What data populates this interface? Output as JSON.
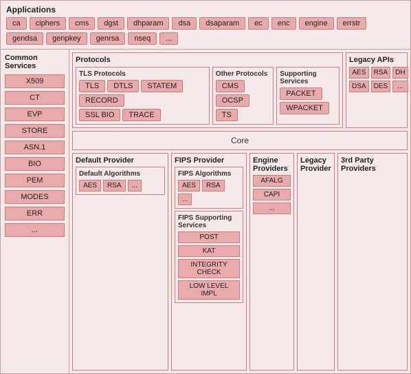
{
  "applications": {
    "title": "Applications",
    "tags": [
      "ca",
      "ciphers",
      "cms",
      "dgst",
      "dhparam",
      "dsa",
      "dsaparam",
      "ec",
      "enc",
      "engine",
      "errstr",
      "gendsa",
      "genpkey",
      "genrsa",
      "nseq",
      "..."
    ]
  },
  "common_services": {
    "title": "Common Services",
    "items": [
      "X509",
      "CT",
      "EVP",
      "STORE",
      "ASN.1",
      "BIO",
      "PEM",
      "MODES",
      "ERR",
      "..."
    ]
  },
  "protocols": {
    "title": "Protocols",
    "tls": {
      "title": "TLS Protocols",
      "row1": [
        "TLS",
        "DTLS",
        "STATEM",
        "RECORD"
      ],
      "row2": [
        "SSL BIO",
        "TRACE"
      ]
    },
    "other": {
      "title": "Other Protocols",
      "items": [
        "CMS",
        "OCSP",
        "TS"
      ]
    },
    "supporting": {
      "title": "Supporting Services",
      "items": [
        "PACKET",
        "WPACKET"
      ]
    }
  },
  "legacy_apis": {
    "title": "Legacy APIs",
    "items": [
      "AES",
      "RSA",
      "DH",
      "DSA",
      "DES",
      "..."
    ]
  },
  "core": {
    "label": "Core"
  },
  "default_provider": {
    "title": "Default Provider",
    "algorithms_title": "Default Algorithms",
    "algorithms": [
      "AES",
      "RSA",
      "..."
    ]
  },
  "fips_provider": {
    "title": "FIPS Provider",
    "algorithms_title": "FIPS Algorithms",
    "algorithms": [
      "AES",
      "RSA",
      "..."
    ],
    "supporting_title": "FIPS Supporting Services",
    "supporting_items": [
      "POST",
      "KAT",
      "INTEGRITY CHECK",
      "LOW LEVEL IMPL"
    ]
  },
  "engine_providers": {
    "title": "Engine Providers",
    "items": [
      "AFALG",
      "CAPI",
      "..."
    ]
  },
  "legacy_provider": {
    "title": "Legacy Provider"
  },
  "third_party_providers": {
    "title": "3rd Party Providers"
  }
}
